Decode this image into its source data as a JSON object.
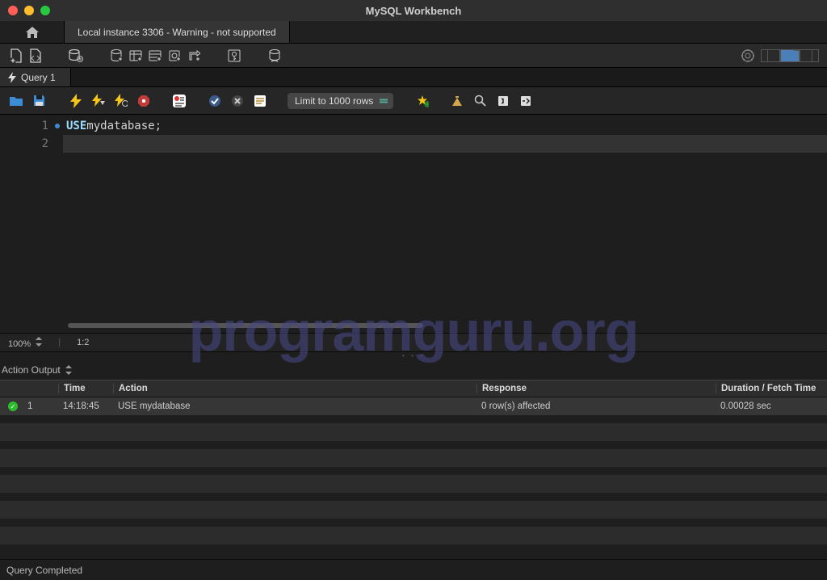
{
  "app_title": "MySQL Workbench",
  "connection_tab": "Local instance 3306 - Warning - not supported",
  "query_tab": "Query 1",
  "limit_dropdown": "Limit to 1000 rows",
  "editor": {
    "lines": [
      {
        "n": "1",
        "kw": "USE",
        "rest": " mydatabase;",
        "active": true,
        "hl": false
      },
      {
        "n": "2",
        "kw": "",
        "rest": "",
        "active": false,
        "hl": true
      }
    ],
    "zoom": "100%",
    "cursor_pos": "1:2"
  },
  "action_output_label": "Action Output",
  "columns": {
    "time": "Time",
    "action": "Action",
    "response": "Response",
    "duration": "Duration / Fetch Time"
  },
  "rows": [
    {
      "num": "1",
      "time": "14:18:45",
      "action": "USE mydatabase",
      "response": "0 row(s) affected",
      "duration": "0.00028 sec"
    }
  ],
  "footer_status": "Query Completed",
  "watermark": "programguru.org"
}
